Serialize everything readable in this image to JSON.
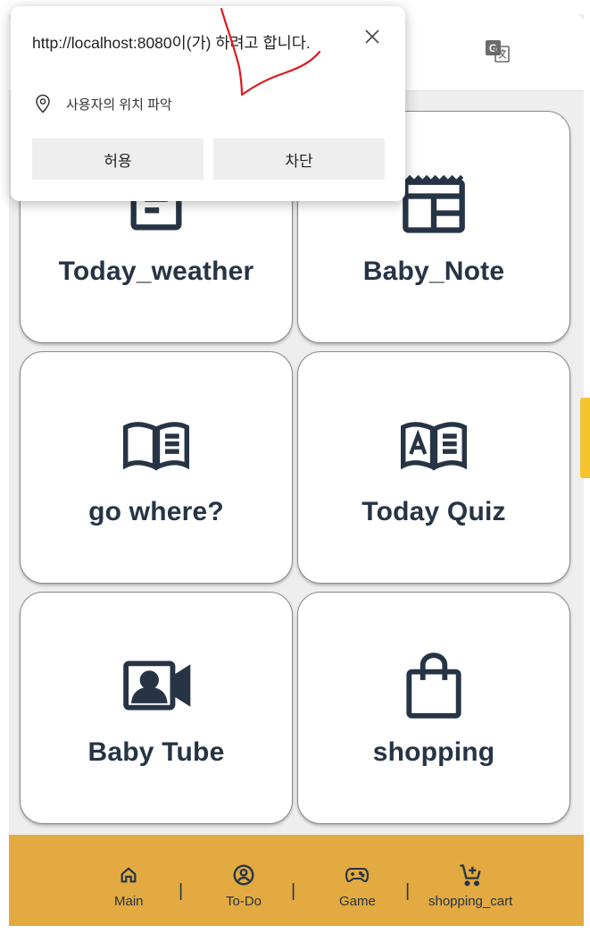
{
  "permission_popup": {
    "title": "http://localhost:8080이(가) 하려고 합니다.",
    "permission_text": "사용자의 위치 파악",
    "allow_label": "허용",
    "block_label": "차단"
  },
  "cards": [
    {
      "label": "Today_weather",
      "icon": "article-icon"
    },
    {
      "label": "Baby_Note",
      "icon": "calendar-layout-icon"
    },
    {
      "label": "go where?",
      "icon": "open-book-icon"
    },
    {
      "label": "Today Quiz",
      "icon": "quiz-book-icon"
    },
    {
      "label": "Baby Tube",
      "icon": "video-contact-icon"
    },
    {
      "label": "shopping",
      "icon": "shopping-bag-icon"
    }
  ],
  "nav": [
    {
      "label": "Main",
      "icon": "home-icon"
    },
    {
      "label": "To-Do",
      "icon": "account-circle-icon"
    },
    {
      "label": "Game",
      "icon": "gamepad-icon"
    },
    {
      "label": "shopping_cart",
      "icon": "cart-add-icon"
    }
  ],
  "nav_separator": "|",
  "colors": {
    "nav_bg": "#e2aa40",
    "icon_color": "#263445",
    "background": "#eeeeee",
    "scroll_accent": "#f4c430",
    "annotation": "#e0191e"
  }
}
